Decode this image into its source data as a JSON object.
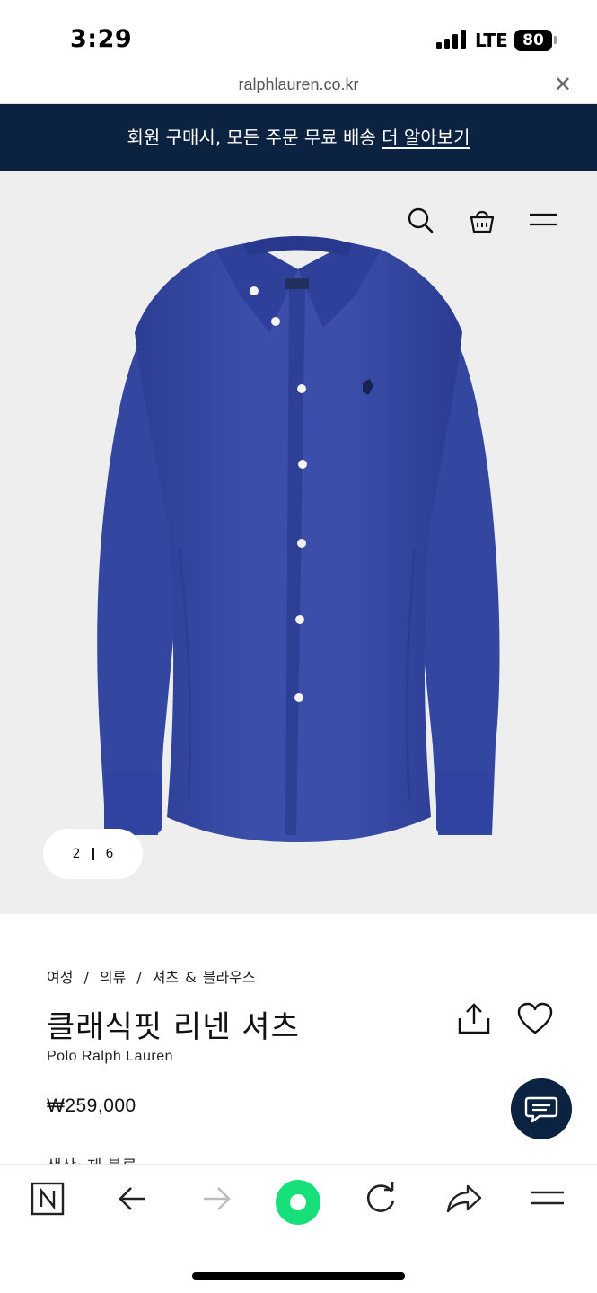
{
  "status_bar": {
    "time": "3:29",
    "network": "LTE",
    "battery": "80"
  },
  "browser": {
    "url": "ralphlauren.co.kr",
    "close_glyph": "✕"
  },
  "promo": {
    "text": "회원 구매시, 모든 주문 무료 배송",
    "link": "더 알아보기"
  },
  "header_icons": [
    "search-icon",
    "shopping-bag-icon",
    "menu-icon"
  ],
  "gallery": {
    "current": "2",
    "total": "6"
  },
  "breadcrumb": [
    "여성",
    "의류",
    "셔츠 & 블라우스"
  ],
  "product": {
    "title": "클래식핏 리넨 셔츠",
    "brand": "Polo Ralph Lauren",
    "price": "₩259,000",
    "color_label": "색상: 제 블루"
  },
  "bottom_bar": [
    "n-logo-icon",
    "back-arrow-icon",
    "forward-arrow-icon",
    "green-dot-icon",
    "refresh-icon",
    "share-arrow-icon",
    "menu-icon"
  ],
  "colors": {
    "navy": "#0b2240",
    "shirt_blue": "#3447a0",
    "accent_green": "#17e07a",
    "hero_bg": "#efeeee"
  }
}
